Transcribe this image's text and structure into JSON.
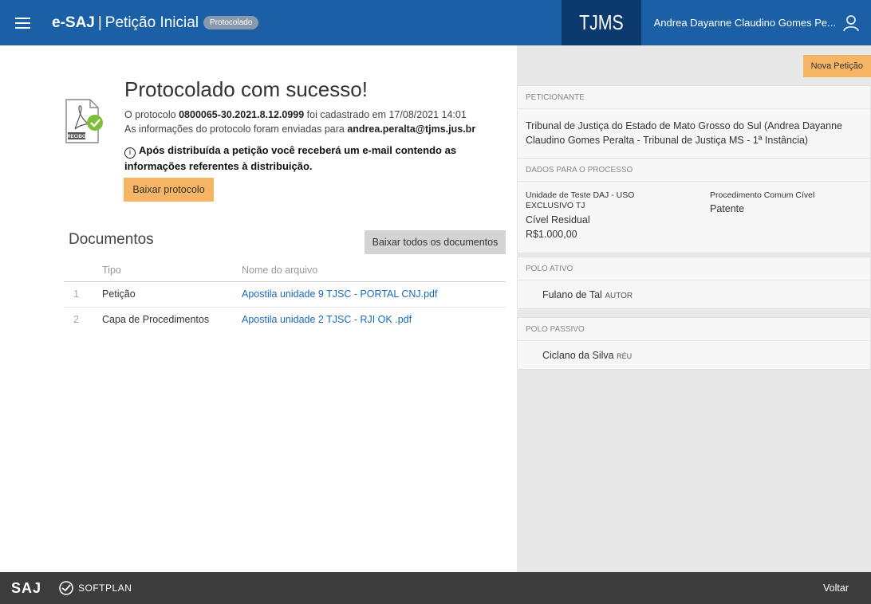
{
  "header": {
    "app_name": "e-SAJ",
    "separator": "|",
    "page_title": "Petição Inicial",
    "status_badge": "Protocolado",
    "court": "TJMS",
    "user_name": "Andrea Dayanne Claudino Gomes Pe..."
  },
  "main": {
    "recibo_label": "RECIBO",
    "success_title": "Protocolado com sucesso!",
    "protocol_prefix": "O protocolo ",
    "protocol_number": "0800065-30.2021.8.12.0999",
    "protocol_suffix": " foi cadastrado em 17/08/2021 14:01",
    "email_prefix": "As informações do protocolo foram enviadas para ",
    "email": "andrea.peralta@tjms.jus.br",
    "notice_line1": "Após distribuída a petição você receberá um e-mail contendo as",
    "notice_line2": "informações referentes à distribuição.",
    "download_button": "Baixar protocolo"
  },
  "documents": {
    "title": "Documentos",
    "download_all_button": "Baixar todos os documentos",
    "col_type": "Tipo",
    "col_file": "Nome do arquivo",
    "rows": [
      {
        "num": "1",
        "type": "Petição",
        "file": "Apostila unidade 9 TJSC - PORTAL CNJ.pdf"
      },
      {
        "num": "2",
        "type": "Capa de Procedimentos",
        "file": "Apostila unidade 2 TJSC - RJI OK .pdf"
      }
    ]
  },
  "side": {
    "new_petition_button": "Nova Petição",
    "peticionante_label": "PETICIONANTE",
    "peticionante_text": "Tribunal de Justiça do Estado de Mato Grosso do Sul (Andrea Dayanne Claudino Gomes Peralta - Tribunal de Justiça MS - 1ª Instância)",
    "dados_label": "DADOS PARA O PROCESSO",
    "unidade": "Unidade de Teste DAJ - USO EXCLUSIVO TJ",
    "classe": "Cível Residual",
    "valor": "R$1.000,00",
    "procedimento": "Procedimento Comum Cível",
    "assunto": "Patente",
    "polo_ativo_label": "POLO ATIVO",
    "polo_ativo_name": "Fulano de Tal",
    "polo_ativo_role": "AUTOR",
    "polo_passivo_label": "POLO PASSIVO",
    "polo_passivo_name": "Ciclano da Silva",
    "polo_passivo_role": "RÉU"
  },
  "footer": {
    "saj_logo": "SAJ",
    "softplan_logo": "SOFTPLAN",
    "back_link": "Voltar"
  },
  "colors": {
    "header_bg": "#1b5fa6",
    "court_bg": "#0d3a6e",
    "accent_orange": "#f6b565",
    "link_blue": "#1b69b6",
    "footer_bg": "#3c3c3c",
    "side_bg": "#e8e8e8"
  }
}
